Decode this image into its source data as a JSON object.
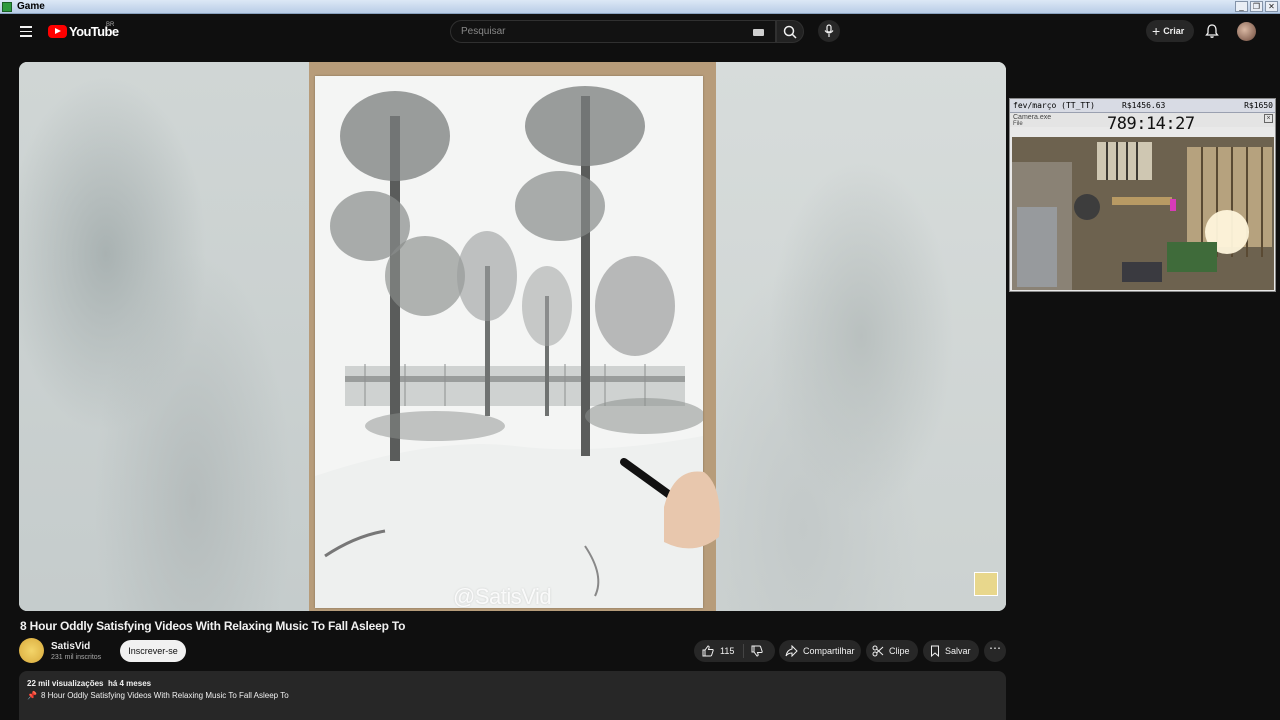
{
  "os_window": {
    "title": "Game",
    "controls": [
      "_",
      "❐",
      "✕"
    ]
  },
  "header": {
    "logo_text": "YouTube",
    "country_code": "BR",
    "search": {
      "placeholder": "Pesquisar",
      "value": ""
    },
    "create_label": "Criar"
  },
  "player": {
    "watermark": "@SatisVid"
  },
  "overlay": {
    "top_left": "fev/março (TT_TT)",
    "top_mid": "R$1456.63",
    "top_right": "R$1650",
    "camera_title": "Camera.exe",
    "camera_file": "File",
    "timer": "789:14:27"
  },
  "video": {
    "title": "8 Hour Oddly Satisfying Videos With Relaxing Music To Fall Asleep To",
    "channel_name": "SatisVid",
    "channel_subs": "231 mil inscritos",
    "subscribe_label": "Inscrever-se",
    "like_count": "115",
    "share_label": "Compartilhar",
    "clip_label": "Clipe",
    "save_label": "Salvar",
    "views": "22 mil visualizações",
    "age": "há 4 meses",
    "description_first_line": "8 Hour Oddly Satisfying Videos With Relaxing Music To Fall Asleep To"
  },
  "icons": [
    "menu-icon",
    "youtube-logo-icon",
    "keyboard-icon",
    "search-icon",
    "mic-icon",
    "plus-icon",
    "bell-icon",
    "like-icon",
    "dislike-icon",
    "share-icon",
    "scissors-icon",
    "bookmark-icon",
    "more-icon",
    "pin-icon"
  ],
  "colors": {
    "background": "#0f0f0f",
    "brand_red": "#ff0000",
    "pill_bg": "#272727",
    "subscribe_bg": "#f1f1f1"
  }
}
